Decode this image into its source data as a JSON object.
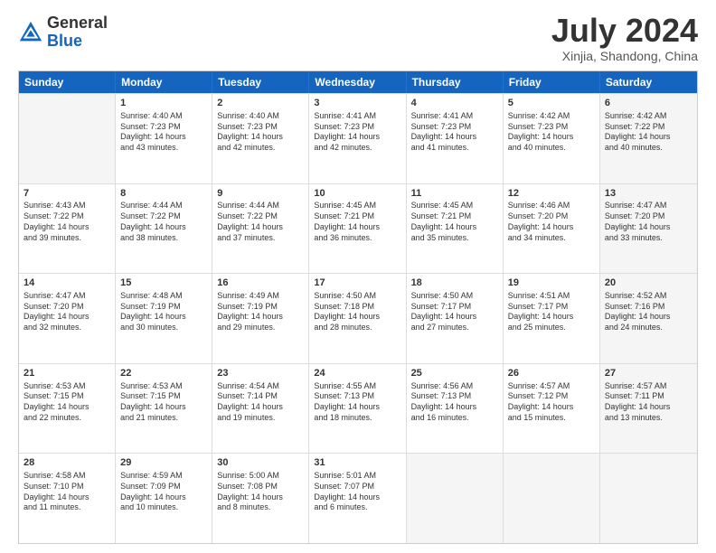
{
  "header": {
    "logo_general": "General",
    "logo_blue": "Blue",
    "month_title": "July 2024",
    "location": "Xinjia, Shandong, China"
  },
  "days": [
    "Sunday",
    "Monday",
    "Tuesday",
    "Wednesday",
    "Thursday",
    "Friday",
    "Saturday"
  ],
  "rows": [
    [
      {
        "day": "",
        "info": "",
        "shade": true
      },
      {
        "day": "1",
        "info": "Sunrise: 4:40 AM\nSunset: 7:23 PM\nDaylight: 14 hours\nand 43 minutes.",
        "shade": false
      },
      {
        "day": "2",
        "info": "Sunrise: 4:40 AM\nSunset: 7:23 PM\nDaylight: 14 hours\nand 42 minutes.",
        "shade": false
      },
      {
        "day": "3",
        "info": "Sunrise: 4:41 AM\nSunset: 7:23 PM\nDaylight: 14 hours\nand 42 minutes.",
        "shade": false
      },
      {
        "day": "4",
        "info": "Sunrise: 4:41 AM\nSunset: 7:23 PM\nDaylight: 14 hours\nand 41 minutes.",
        "shade": false
      },
      {
        "day": "5",
        "info": "Sunrise: 4:42 AM\nSunset: 7:23 PM\nDaylight: 14 hours\nand 40 minutes.",
        "shade": false
      },
      {
        "day": "6",
        "info": "Sunrise: 4:42 AM\nSunset: 7:22 PM\nDaylight: 14 hours\nand 40 minutes.",
        "shade": true
      }
    ],
    [
      {
        "day": "7",
        "info": "Sunrise: 4:43 AM\nSunset: 7:22 PM\nDaylight: 14 hours\nand 39 minutes.",
        "shade": false
      },
      {
        "day": "8",
        "info": "Sunrise: 4:44 AM\nSunset: 7:22 PM\nDaylight: 14 hours\nand 38 minutes.",
        "shade": false
      },
      {
        "day": "9",
        "info": "Sunrise: 4:44 AM\nSunset: 7:22 PM\nDaylight: 14 hours\nand 37 minutes.",
        "shade": false
      },
      {
        "day": "10",
        "info": "Sunrise: 4:45 AM\nSunset: 7:21 PM\nDaylight: 14 hours\nand 36 minutes.",
        "shade": false
      },
      {
        "day": "11",
        "info": "Sunrise: 4:45 AM\nSunset: 7:21 PM\nDaylight: 14 hours\nand 35 minutes.",
        "shade": false
      },
      {
        "day": "12",
        "info": "Sunrise: 4:46 AM\nSunset: 7:20 PM\nDaylight: 14 hours\nand 34 minutes.",
        "shade": false
      },
      {
        "day": "13",
        "info": "Sunrise: 4:47 AM\nSunset: 7:20 PM\nDaylight: 14 hours\nand 33 minutes.",
        "shade": true
      }
    ],
    [
      {
        "day": "14",
        "info": "Sunrise: 4:47 AM\nSunset: 7:20 PM\nDaylight: 14 hours\nand 32 minutes.",
        "shade": false
      },
      {
        "day": "15",
        "info": "Sunrise: 4:48 AM\nSunset: 7:19 PM\nDaylight: 14 hours\nand 30 minutes.",
        "shade": false
      },
      {
        "day": "16",
        "info": "Sunrise: 4:49 AM\nSunset: 7:19 PM\nDaylight: 14 hours\nand 29 minutes.",
        "shade": false
      },
      {
        "day": "17",
        "info": "Sunrise: 4:50 AM\nSunset: 7:18 PM\nDaylight: 14 hours\nand 28 minutes.",
        "shade": false
      },
      {
        "day": "18",
        "info": "Sunrise: 4:50 AM\nSunset: 7:17 PM\nDaylight: 14 hours\nand 27 minutes.",
        "shade": false
      },
      {
        "day": "19",
        "info": "Sunrise: 4:51 AM\nSunset: 7:17 PM\nDaylight: 14 hours\nand 25 minutes.",
        "shade": false
      },
      {
        "day": "20",
        "info": "Sunrise: 4:52 AM\nSunset: 7:16 PM\nDaylight: 14 hours\nand 24 minutes.",
        "shade": true
      }
    ],
    [
      {
        "day": "21",
        "info": "Sunrise: 4:53 AM\nSunset: 7:15 PM\nDaylight: 14 hours\nand 22 minutes.",
        "shade": false
      },
      {
        "day": "22",
        "info": "Sunrise: 4:53 AM\nSunset: 7:15 PM\nDaylight: 14 hours\nand 21 minutes.",
        "shade": false
      },
      {
        "day": "23",
        "info": "Sunrise: 4:54 AM\nSunset: 7:14 PM\nDaylight: 14 hours\nand 19 minutes.",
        "shade": false
      },
      {
        "day": "24",
        "info": "Sunrise: 4:55 AM\nSunset: 7:13 PM\nDaylight: 14 hours\nand 18 minutes.",
        "shade": false
      },
      {
        "day": "25",
        "info": "Sunrise: 4:56 AM\nSunset: 7:13 PM\nDaylight: 14 hours\nand 16 minutes.",
        "shade": false
      },
      {
        "day": "26",
        "info": "Sunrise: 4:57 AM\nSunset: 7:12 PM\nDaylight: 14 hours\nand 15 minutes.",
        "shade": false
      },
      {
        "day": "27",
        "info": "Sunrise: 4:57 AM\nSunset: 7:11 PM\nDaylight: 14 hours\nand 13 minutes.",
        "shade": true
      }
    ],
    [
      {
        "day": "28",
        "info": "Sunrise: 4:58 AM\nSunset: 7:10 PM\nDaylight: 14 hours\nand 11 minutes.",
        "shade": false
      },
      {
        "day": "29",
        "info": "Sunrise: 4:59 AM\nSunset: 7:09 PM\nDaylight: 14 hours\nand 10 minutes.",
        "shade": false
      },
      {
        "day": "30",
        "info": "Sunrise: 5:00 AM\nSunset: 7:08 PM\nDaylight: 14 hours\nand 8 minutes.",
        "shade": false
      },
      {
        "day": "31",
        "info": "Sunrise: 5:01 AM\nSunset: 7:07 PM\nDaylight: 14 hours\nand 6 minutes.",
        "shade": false
      },
      {
        "day": "",
        "info": "",
        "shade": true
      },
      {
        "day": "",
        "info": "",
        "shade": true
      },
      {
        "day": "",
        "info": "",
        "shade": true
      }
    ]
  ]
}
